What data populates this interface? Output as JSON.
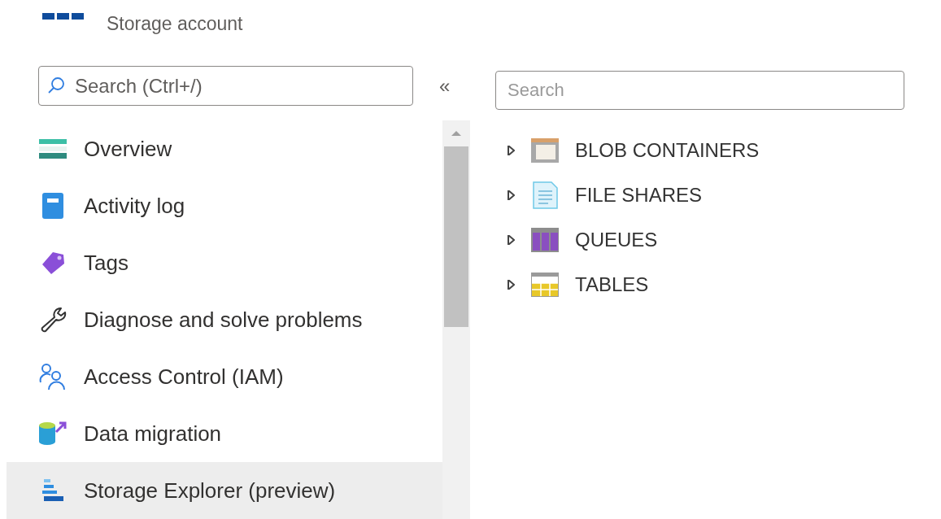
{
  "header": {
    "subtitle": "Storage account"
  },
  "menu_search": {
    "placeholder": "Search (Ctrl+/)"
  },
  "collapse": {
    "label": "«"
  },
  "menu": [
    {
      "label": "Overview",
      "selected": false
    },
    {
      "label": "Activity log",
      "selected": false
    },
    {
      "label": "Tags",
      "selected": false
    },
    {
      "label": "Diagnose and solve problems",
      "selected": false
    },
    {
      "label": "Access Control (IAM)",
      "selected": false
    },
    {
      "label": "Data migration",
      "selected": false
    },
    {
      "label": "Storage Explorer (preview)",
      "selected": true
    }
  ],
  "explorer_search": {
    "placeholder": "Search"
  },
  "tree": [
    {
      "label": "BLOB CONTAINERS",
      "kind": "blob",
      "expanded": false
    },
    {
      "label": "FILE SHARES",
      "kind": "file",
      "expanded": false
    },
    {
      "label": "QUEUES",
      "kind": "queue",
      "expanded": false
    },
    {
      "label": "TABLES",
      "kind": "table",
      "expanded": false
    }
  ]
}
